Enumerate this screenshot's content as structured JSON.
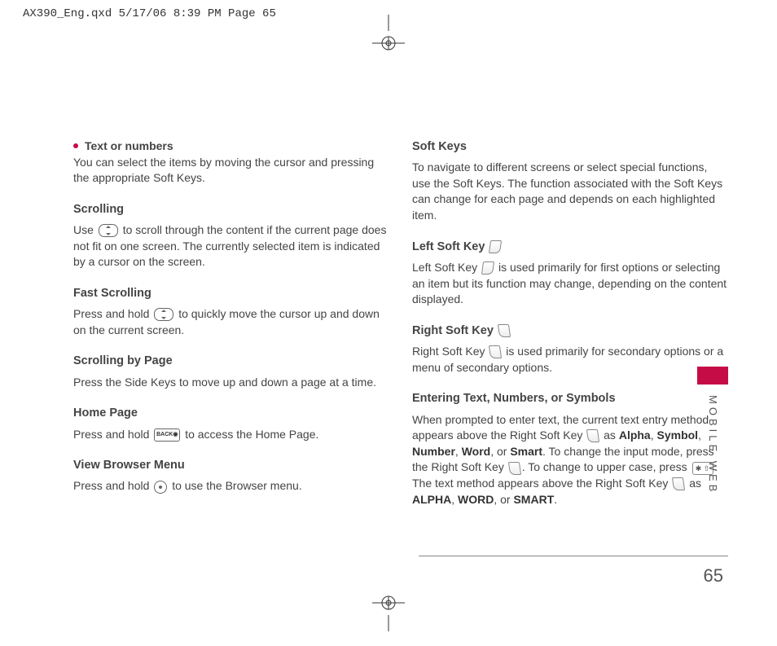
{
  "cropHeader": "AX390_Eng.qxd  5/17/06  8:39 PM  Page 65",
  "left": {
    "bulletTitle": "Text or numbers",
    "bulletBody": "You can select the items by moving the cursor and pressing the appropriate Soft Keys.",
    "scrollingTitle": "Scrolling",
    "scrollingBody1": "Use ",
    "scrollingBody2": " to scroll through the content if the current page does not fit on one screen. The currently selected item is indicated by a cursor on the screen.",
    "fastTitle": "Fast Scrolling",
    "fastBody1": "Press and hold ",
    "fastBody2": " to quickly move the cursor up and down on the current screen.",
    "byPageTitle": "Scrolling by Page",
    "byPageBody": "Press the Side Keys to move up and down a page at a time.",
    "homeTitle": "Home Page",
    "homeBody1": "Press and hold ",
    "homeBody2": " to access the Home Page.",
    "menuTitle": "View Browser Menu",
    "menuBody1": "Press and hold ",
    "menuBody2": " to use the Browser menu.",
    "backLabel": "BACK◉"
  },
  "right": {
    "softTitle": "Soft Keys",
    "softBody": "To navigate to different screens or select special functions, use the Soft Keys. The function associated with the Soft Keys can change for each page and depends on each highlighted item.",
    "leftKeyTitle": "Left Soft Key ",
    "leftKeyBody1": "Left Soft Key ",
    "leftKeyBody2": " is used primarily for first options or selecting an item but its function may change, depending on the content displayed.",
    "rightKeyTitle": "Right Soft Key ",
    "rightKeyBody1": "Right Soft Key ",
    "rightKeyBody2": " is used primarily for secondary options or a menu of secondary options.",
    "enterTitle": "Entering Text, Numbers, or Symbols",
    "enterBody1": "When prompted to enter text, the current text entry method appears above the Right Soft Key ",
    "enterBody2": " as ",
    "enterBody3": ". To change the input mode, press the Right Soft Key ",
    "enterBody4": ". To change to upper case, press ",
    "enterBody5": ". The text method appears above the Right Soft Key ",
    "enterBody6": " as ",
    "enterBody7": ".",
    "modesLower": {
      "a": "Alpha",
      "s": "Symbol",
      "n": "Number",
      "w": "Word",
      "sm": "Smart"
    },
    "modesUpper": {
      "a": "ALPHA",
      "w": "WORD",
      "sm": "SMART"
    },
    "comma": ", ",
    "or": ", or ",
    "starLabel": "✱ ⇧"
  },
  "sideLabel": "MOBILE WEB",
  "pageNum": "65"
}
